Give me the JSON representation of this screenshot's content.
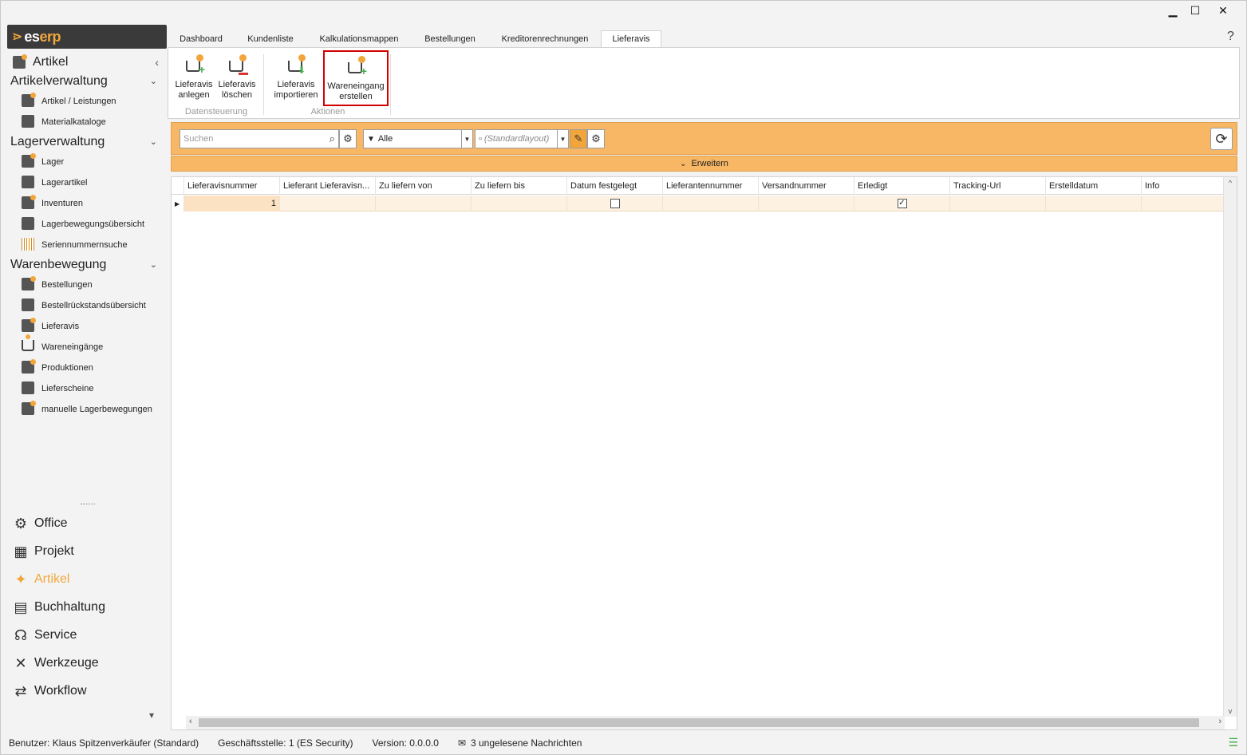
{
  "window": {
    "minimize": "▁",
    "maximize": "☐",
    "close": "✕",
    "help": "?"
  },
  "logo": {
    "mark": "⋗",
    "text_prefix": "es",
    "text_suffix": "erp"
  },
  "sidebar": {
    "top": {
      "label": "Artikel",
      "chevron": "‹"
    },
    "groups": [
      {
        "label": "Artikelverwaltung",
        "chevron": "⌄",
        "items": [
          "Artikel / Leistungen",
          "Materialkataloge"
        ]
      },
      {
        "label": "Lagerverwaltung",
        "chevron": "⌄",
        "items": [
          "Lager",
          "Lagerartikel",
          "Inventuren",
          "Lagerbewegungsübersicht",
          "Seriennummernsuche"
        ]
      },
      {
        "label": "Warenbewegung",
        "chevron": "⌄",
        "items": [
          "Bestellungen",
          "Bestellrückstandsübersicht",
          "Lieferavis",
          "Wareneingänge",
          "Produktionen",
          "Lieferscheine",
          "manuelle Lagerbewegungen"
        ]
      }
    ],
    "modules": [
      "Office",
      "Projekt",
      "Artikel",
      "Buchhaltung",
      "Service",
      "Werkzeuge",
      "Workflow"
    ],
    "active_module": "Artikel",
    "scroll_down": "▾"
  },
  "tabs": [
    "Dashboard",
    "Kundenliste",
    "Kalkulationsmappen",
    "Bestellungen",
    "Kreditorenrechnungen",
    "Lieferavis"
  ],
  "active_tab": "Lieferavis",
  "ribbon": {
    "buttons": [
      {
        "line1": "Lieferavis",
        "line2": "anlegen"
      },
      {
        "line1": "Lieferavis",
        "line2": "löschen"
      },
      {
        "line1": "Lieferavis",
        "line2": "importieren"
      },
      {
        "line1": "Wareneingang",
        "line2": "erstellen"
      }
    ],
    "groups": [
      "Datensteuerung",
      "Aktionen"
    ]
  },
  "toolbar": {
    "search_placeholder": "Suchen",
    "filter_value": "Alle",
    "layout_value": "(Standardlayout)",
    "expand_label": "Erweitern"
  },
  "grid": {
    "columns": [
      "Lieferavisnummer",
      "Lieferant Lieferavisn...",
      "Zu liefern von",
      "Zu liefern bis",
      "Datum festgelegt",
      "Lieferantennummer",
      "Versandnummer",
      "Erledigt",
      "Tracking-Url",
      "Erstelldatum",
      "Info"
    ],
    "rows": [
      {
        "Lieferavisnummer": "1",
        "Datum festgelegt": false,
        "Erledigt": true
      }
    ]
  },
  "status": {
    "user": "Benutzer: Klaus Spitzenverkäufer (Standard)",
    "branch": "Geschäftsstelle: 1 (ES Security)",
    "version": "Version: 0.0.0.0",
    "messages": "3 ungelesene Nachrichten"
  },
  "colors": {
    "accent": "#f2a63a",
    "toolbar": "#f7b764",
    "highlight_border": "#d40000"
  }
}
